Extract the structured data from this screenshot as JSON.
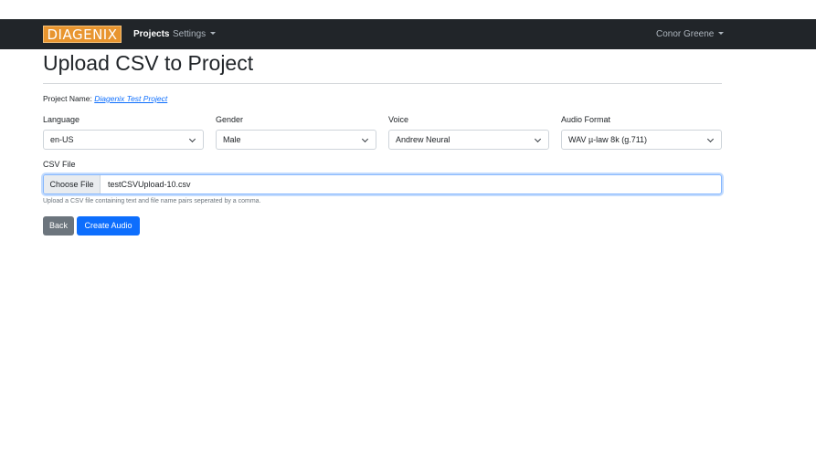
{
  "navbar": {
    "logo_text": "DIAGENIX",
    "projects_label": "Projects",
    "settings_label": "Settings",
    "user_name": "Conor Greene",
    "logo_color": "#e8952f",
    "bg_color": "#212529"
  },
  "page": {
    "title": "Upload CSV to Project"
  },
  "project": {
    "label": "Project Name:",
    "name": "Diagenix Test Project"
  },
  "fields": {
    "language": {
      "label": "Language",
      "value": "en-US"
    },
    "gender": {
      "label": "Gender",
      "value": "Male"
    },
    "voice": {
      "label": "Voice",
      "value": "Andrew Neural"
    },
    "audio_format": {
      "label": "Audio Format",
      "value": "WAV µ-law 8k (g.711)"
    }
  },
  "csv": {
    "label": "CSV File",
    "choose_label": "Choose File",
    "file_name": "testCSVUpload-10.csv",
    "help_text": "Upload a CSV file containing text and file name pairs seperated by a comma."
  },
  "actions": {
    "back_label": "Back",
    "create_label": "Create Audio",
    "primary_color": "#0d6efd",
    "secondary_color": "#6c757d"
  }
}
